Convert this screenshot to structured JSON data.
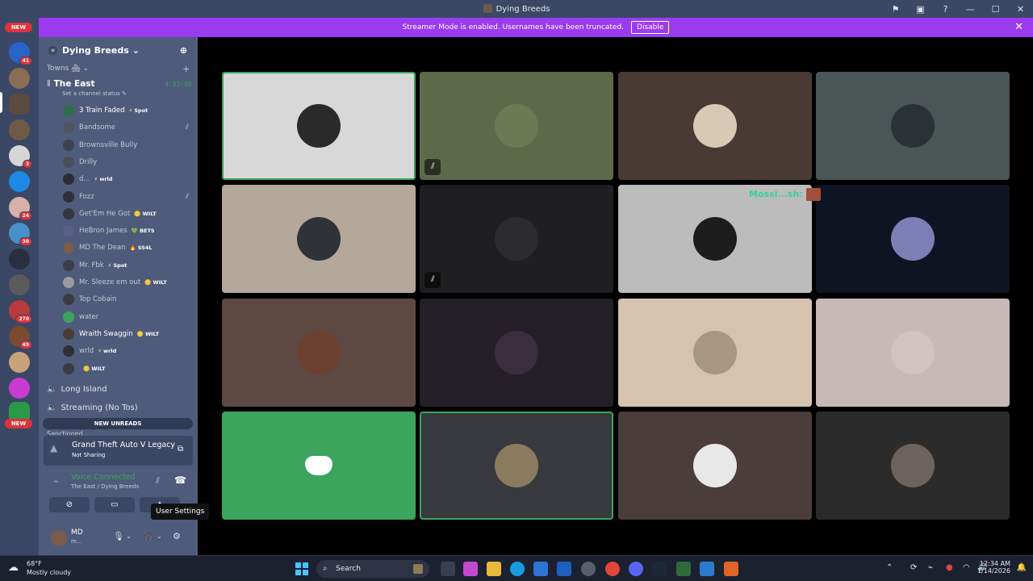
{
  "window": {
    "title": "Dying Breeds"
  },
  "banner": {
    "text": "Streamer Mode is enabled. Usernames have been truncated.",
    "disable_label": "Disable"
  },
  "server_rail": {
    "new_top": "NEW",
    "new_bottom": "NEW",
    "badges": [
      "41",
      "3",
      "24",
      "30",
      "270",
      "49"
    ]
  },
  "guild": {
    "name": "Dying Breeds",
    "chevron": "⌄"
  },
  "category": {
    "name": "Towns 🏘 ⌄"
  },
  "voice_channel": {
    "name": "The East",
    "timer": "4:52:00",
    "status_hint": "Set a channel status ✎"
  },
  "members": [
    {
      "name": "3 Train Faded",
      "tag": "⚡ Spot",
      "bright": true,
      "color": "#2f6e4a",
      "muted": false
    },
    {
      "name": "Bandsome",
      "tag": "",
      "bright": false,
      "color": "#51545c",
      "muted": true
    },
    {
      "name": "Brownsville Bully",
      "tag": "",
      "bright": false,
      "color": "#3d4251",
      "muted": false
    },
    {
      "name": "Drilly",
      "tag": "",
      "bright": false,
      "color": "#4a4e58",
      "muted": false
    },
    {
      "name": "d...",
      "tag": "⚡ wrld",
      "bright": false,
      "color": "#2a2d34",
      "muted": false
    },
    {
      "name": "Fozz",
      "tag": "",
      "bright": false,
      "color": "#2f3138",
      "muted": true
    },
    {
      "name": "Get'Em He Got",
      "tag": "🪙 WILT",
      "bright": false,
      "color": "#33363e",
      "muted": false
    },
    {
      "name": "HeBron James",
      "tag": "💚 BETS",
      "bright": false,
      "color": "#5a5f88",
      "muted": false
    },
    {
      "name": "MD The Dean",
      "tag": "🔥 SS4L",
      "bright": false,
      "color": "#7c5b4d",
      "muted": false
    },
    {
      "name": "Mr. Fbk",
      "tag": "⚡ Spot",
      "bright": false,
      "color": "#3b3e46",
      "muted": false
    },
    {
      "name": "Mr. Sleeze em out",
      "tag": "🪙 WILT",
      "bright": false,
      "color": "#9a9aa0",
      "muted": false
    },
    {
      "name": "Top Cobain",
      "tag": "",
      "bright": false,
      "color": "#3a3c42",
      "muted": false
    },
    {
      "name": "water",
      "tag": "",
      "bright": false,
      "color": "#3ba55d",
      "muted": false
    },
    {
      "name": "Wraith Swaggin",
      "tag": "🪙 WILT",
      "bright": true,
      "color": "#4b3b36",
      "muted": false
    },
    {
      "name": "wrld",
      "tag": "⚡ wrld",
      "bright": false,
      "color": "#2c2f36",
      "muted": false
    },
    {
      "name": "",
      "tag": "🪙 WILT",
      "bright": false,
      "color": "#3b3a3f",
      "muted": false
    }
  ],
  "channels": [
    {
      "name": "Long Island"
    },
    {
      "name": "Streaming (No Tos)"
    }
  ],
  "new_unreads": "NEW UNREADS",
  "next_category": "Sanctioned",
  "activity": {
    "game": "Grand Theft Auto V Legacy",
    "status": "Not Sharing"
  },
  "voice_connected": {
    "title": "Voice Connected",
    "location": "The East / Dying Breeds"
  },
  "user": {
    "name": "MD",
    "sub": "m..."
  },
  "tooltip": "User Settings",
  "overlay_text": "Mossi...sh:",
  "tiles": [
    {
      "bg": "#d8d8d8",
      "face": "#2a2a2a",
      "selected": true,
      "muted": false
    },
    {
      "bg": "#5c6a4a",
      "face": "#6b7a55",
      "selected": false,
      "muted": true
    },
    {
      "bg": "#4a3a34",
      "face": "#d7c9b4",
      "selected": false,
      "muted": false
    },
    {
      "bg": "#4a5556",
      "face": "#2b3235",
      "selected": false,
      "muted": false
    },
    {
      "bg": "#b3a89a",
      "face": "#2f3338",
      "selected": false,
      "muted": false
    },
    {
      "bg": "#1f1f22",
      "face": "#2c2b30",
      "selected": false,
      "muted": true
    },
    {
      "bg": "#bcbcbc",
      "face": "#1d1d1d",
      "selected": false,
      "muted": false
    },
    {
      "bg": "#0f1422",
      "face": "#7b7fb5",
      "selected": false,
      "muted": false
    },
    {
      "bg": "#5e4842",
      "face": "#6b4030",
      "selected": false,
      "muted": false
    },
    {
      "bg": "#241f26",
      "face": "#3a2e3e",
      "selected": false,
      "muted": false
    },
    {
      "bg": "#d6c2ad",
      "face": "#a89780",
      "selected": false,
      "muted": false
    },
    {
      "bg": "#c7b9b8",
      "face": "#d2c2c2",
      "selected": false,
      "muted": false
    },
    {
      "bg": "#3ba55d",
      "face": "#3ba55d",
      "selected": false,
      "muted": false,
      "discord": true
    },
    {
      "bg": "#37393e",
      "face": "#8a7b5f",
      "selected": true,
      "muted": false
    },
    {
      "bg": "#4a3d3a",
      "face": "#e8e8e8",
      "selected": false,
      "muted": false
    },
    {
      "bg": "#2b2b2b",
      "face": "#6c645c",
      "selected": false,
      "muted": false
    }
  ],
  "taskbar": {
    "temp": "68°F",
    "weather": "Mostly cloudy",
    "search": "Search",
    "time": "12:34 AM",
    "date": "1/14/2026"
  }
}
